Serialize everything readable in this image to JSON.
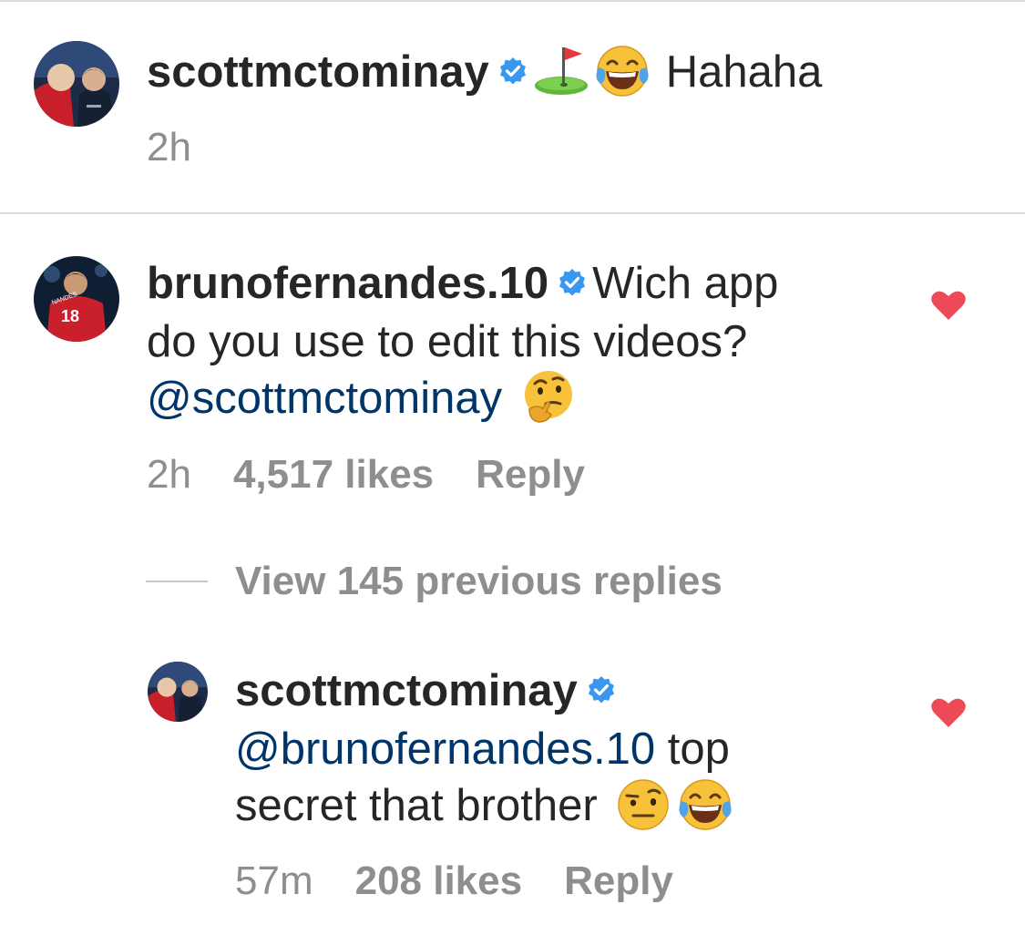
{
  "comments": [
    {
      "username": "scottmctominay",
      "text": "Hahaha",
      "time": "2h"
    },
    {
      "username": "brunofernandes.10",
      "text_line1": "Wich app",
      "text_line2": "do you use to edit this videos?",
      "mention": "@scottmctominay",
      "time": "2h",
      "likes": "4,517 likes",
      "reply_label": "Reply",
      "view_replies": "View 145 previous replies",
      "reply": {
        "username": "scottmctominay",
        "mention": "@brunofernandes.10",
        "text_line1": "top",
        "text_line2": "secret that brother",
        "time": "57m",
        "likes": "208 likes",
        "reply_label": "Reply"
      }
    }
  ],
  "icons": {
    "verified": "verified-badge-icon",
    "golf": "golf-flag-icon",
    "laughing": "tears-of-joy-icon",
    "thinking": "thinking-face-icon",
    "raised_eyebrow": "raised-eyebrow-face-icon",
    "heart": "heart-icon"
  },
  "colors": {
    "verified_blue": "#3897f0",
    "heart_red": "#ed4956",
    "mention_blue": "#003569",
    "meta_gray": "#8e8e8e"
  }
}
